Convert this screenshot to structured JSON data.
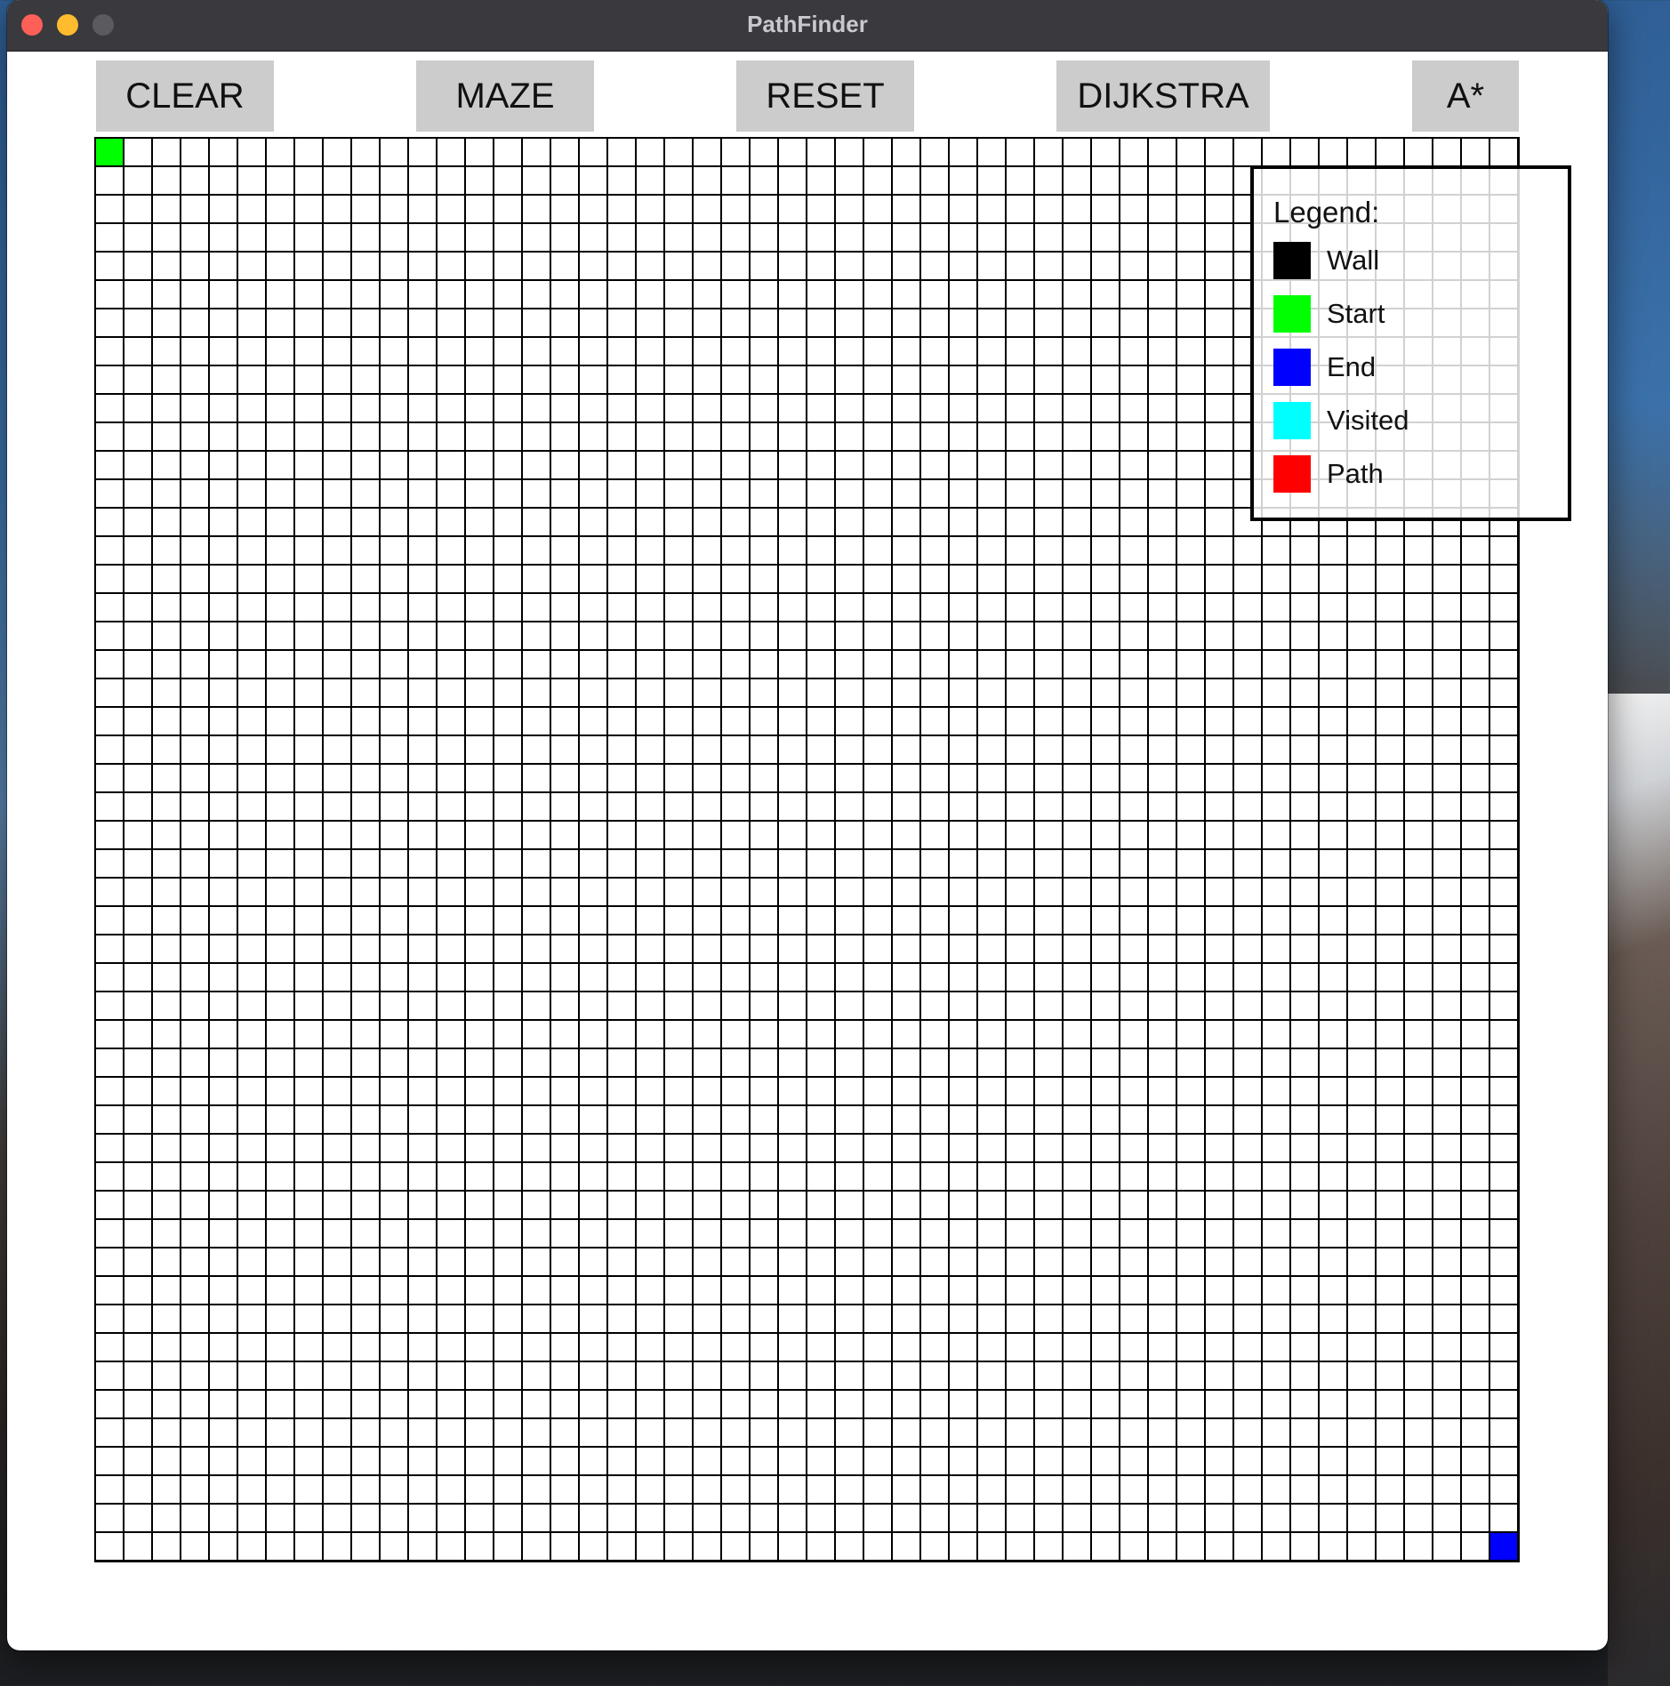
{
  "window": {
    "title": "PathFinder"
  },
  "toolbar": {
    "clear_label": "CLEAR",
    "maze_label": "MAZE",
    "reset_label": "RESET",
    "dijkstra_label": "DIJKSTRA",
    "astar_label": "A*"
  },
  "grid": {
    "rows": 50,
    "cols": 50,
    "start_cell": {
      "row": 0,
      "col": 0
    },
    "end_cell": {
      "row": 49,
      "col": 49
    }
  },
  "legend": {
    "title": "Legend:",
    "items": [
      {
        "label": "Wall",
        "color": "#000000"
      },
      {
        "label": "Start",
        "color": "#00ff00"
      },
      {
        "label": "End",
        "color": "#0000ff"
      },
      {
        "label": "Visited",
        "color": "#00ffff"
      },
      {
        "label": "Path",
        "color": "#ff0000"
      }
    ]
  },
  "colors": {
    "button_bg": "#cccccc",
    "titlebar_bg": "#3a393d",
    "grid_line": "#000000",
    "start": "#00ff00",
    "end": "#0000ff"
  }
}
